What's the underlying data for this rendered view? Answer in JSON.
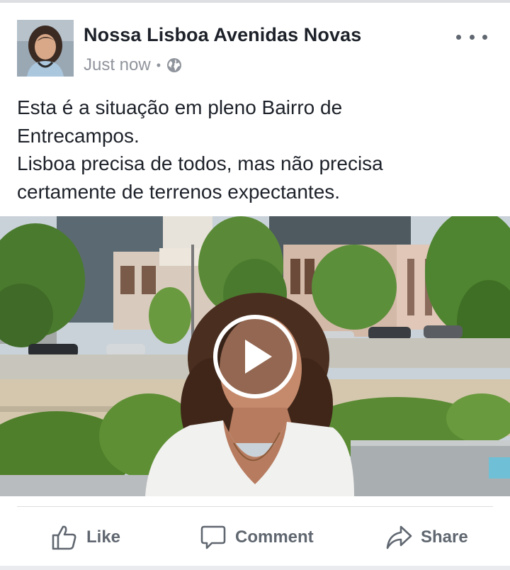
{
  "post": {
    "author": "Nossa Lisboa Avenidas Novas",
    "timestamp": "Just now",
    "separator": "•",
    "privacy_icon": "globe-icon",
    "more_icon": "more-options-icon",
    "text_lines": [
      "Esta é a situação em pleno Bairro de",
      "Entrecampos.",
      "Lisboa precisa de todos, mas não precisa",
      "certamente de terrenos expectantes."
    ]
  },
  "video": {
    "play_icon": "play-icon"
  },
  "actions": {
    "like": "Like",
    "comment": "Comment",
    "share": "Share"
  },
  "colors": {
    "author": "#1d2129",
    "meta": "#90949c",
    "action": "#606770",
    "divider": "#dadde1"
  }
}
